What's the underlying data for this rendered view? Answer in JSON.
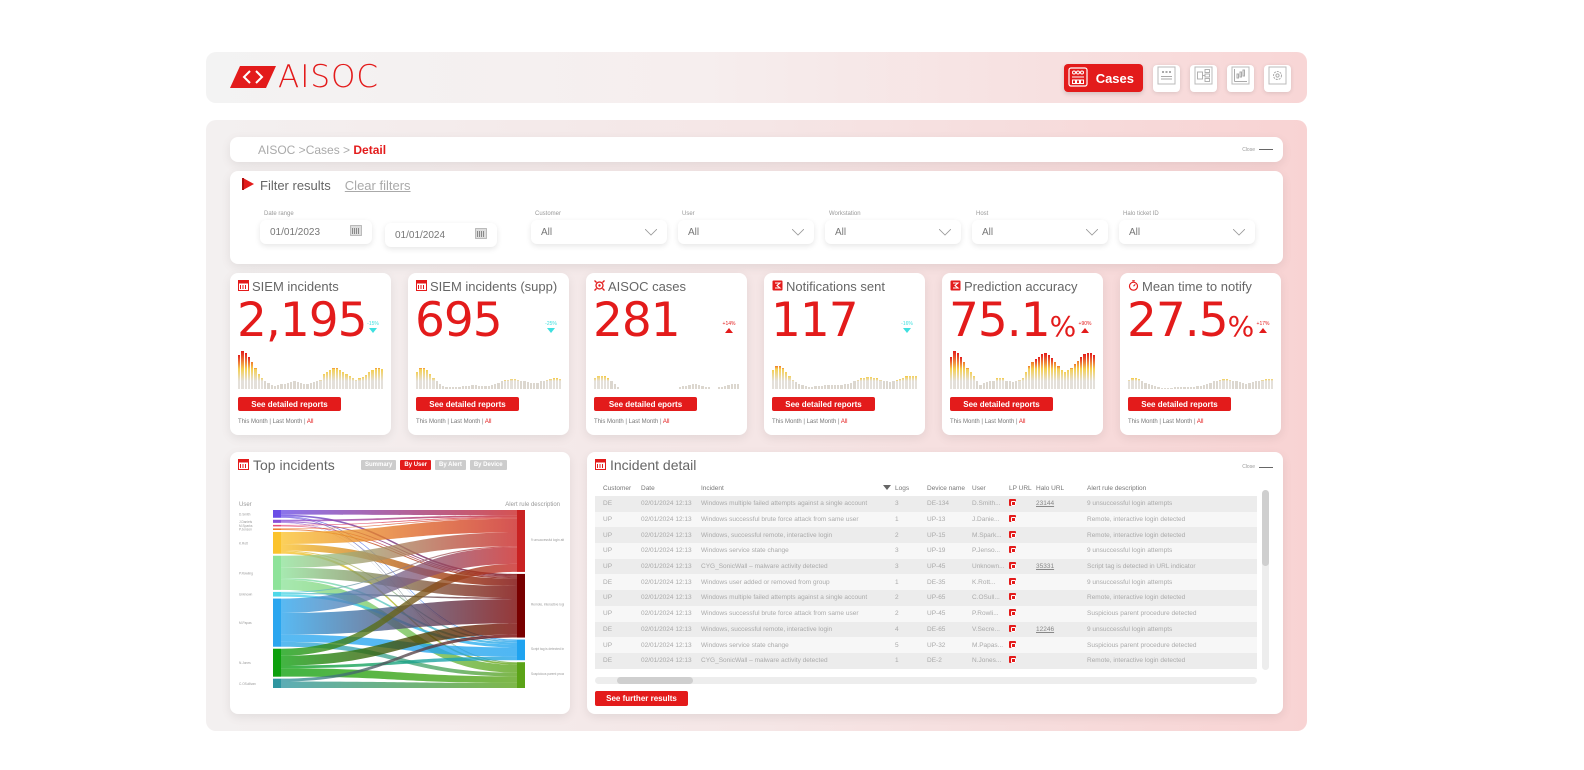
{
  "app": {
    "logo_text": "AISOC",
    "brand_color": "#e31b1b",
    "accent_down_color": "#3fe0e0"
  },
  "nav": {
    "cases_label": "Cases",
    "items": [
      {
        "icon": "cases-icon",
        "label": "Cases",
        "active": true
      },
      {
        "icon": "dashboard-icon",
        "active": false
      },
      {
        "icon": "network-icon",
        "active": false
      },
      {
        "icon": "chart-icon",
        "active": false
      },
      {
        "icon": "gear-icon",
        "active": false
      }
    ]
  },
  "breadcrumb": {
    "root": "AISOC",
    "sep1": " >",
    "mid": "Cases",
    "sep2": " > ",
    "current": "Detail",
    "close_label": "Close"
  },
  "filters": {
    "title": "Filter results",
    "clear_label": "Clear filters",
    "date_range_label": "Date range",
    "date_from": "01/01/2023",
    "date_to": "01/01/2024",
    "customer_label": "Customer",
    "customer_value": "All",
    "user_label": "User",
    "user_value": "All",
    "workstation_label": "Workstation",
    "workstation_value": "All",
    "host_label": "Host",
    "host_value": "All",
    "halo_label": "Halo ticket ID",
    "halo_value": "All"
  },
  "kpis": [
    {
      "title": "SIEM incidents",
      "icon": "calendar-icon",
      "value": "2,195",
      "suffix": "",
      "delta": "-15%",
      "direction": "down",
      "button": "See detailed reports",
      "spark": [
        0.9,
        1.0,
        0.95,
        0.85,
        0.7,
        0.55,
        0.4,
        0.3,
        0.22,
        0.15,
        0.1,
        0.08,
        0.1,
        0.12,
        0.12,
        0.15,
        0.18,
        0.2,
        0.18,
        0.15,
        0.14,
        0.13,
        0.15,
        0.18,
        0.2,
        0.25,
        0.4,
        0.45,
        0.5,
        0.55,
        0.55,
        0.5,
        0.45,
        0.4,
        0.35,
        0.3,
        0.25,
        0.28,
        0.32,
        0.38,
        0.45,
        0.5,
        0.55,
        0.55,
        0.52
      ]
    },
    {
      "title": "SIEM incidents (supp)",
      "icon": "calendar-icon",
      "value": "695",
      "suffix": "",
      "delta": "-25%",
      "direction": "down",
      "button": "See detailed reports",
      "spark": [
        0.45,
        0.55,
        0.55,
        0.5,
        0.4,
        0.3,
        0.2,
        0.12,
        0.08,
        0.06,
        0.05,
        0.05,
        0.05,
        0.06,
        0.07,
        0.08,
        0.09,
        0.1,
        0.1,
        0.09,
        0.08,
        0.08,
        0.09,
        0.1,
        0.12,
        0.15,
        0.2,
        0.23,
        0.25,
        0.27,
        0.27,
        0.25,
        0.22,
        0.2,
        0.18,
        0.16,
        0.15,
        0.17,
        0.2,
        0.22,
        0.25,
        0.27,
        0.28,
        0.28,
        0.27
      ]
    },
    {
      "title": "AISOC cases",
      "icon": "target-icon",
      "value": "281",
      "suffix": "",
      "delta": "+14%",
      "direction": "up",
      "button": "See detailed  eports",
      "spark": [
        0.3,
        0.35,
        0.35,
        0.33,
        0.28,
        0.2,
        0.12,
        0.06,
        0,
        0,
        0,
        0,
        0,
        0,
        0,
        0,
        0,
        0,
        0,
        0,
        0,
        0,
        0,
        0,
        0,
        0,
        0.05,
        0.07,
        0.08,
        0.1,
        0.12,
        0.12,
        0.1,
        0.08,
        0.06,
        0.04,
        0,
        0,
        0.04,
        0.06,
        0.08,
        0.1,
        0.12,
        0.12,
        0.12
      ]
    },
    {
      "title": "Notifications sent",
      "icon": "notification-icon",
      "value": "117",
      "suffix": "",
      "delta": "-16%",
      "direction": "down",
      "button": "See detailed reports",
      "spark": [
        0.5,
        0.6,
        0.6,
        0.55,
        0.45,
        0.35,
        0.25,
        0.18,
        0.12,
        0.1,
        0.08,
        0.06,
        0.06,
        0.07,
        0.08,
        0.09,
        0.1,
        0.1,
        0.1,
        0.1,
        0.1,
        0.1,
        0.12,
        0.14,
        0.16,
        0.2,
        0.25,
        0.28,
        0.3,
        0.32,
        0.32,
        0.3,
        0.28,
        0.25,
        0.22,
        0.2,
        0.18,
        0.2,
        0.23,
        0.26,
        0.3,
        0.33,
        0.35,
        0.35,
        0.35
      ]
    },
    {
      "title": "Prediction accuracy",
      "icon": "notification-icon",
      "value": "75.1",
      "suffix": "%",
      "delta": "+90%",
      "direction": "up",
      "button": "See detailed reports",
      "spark": [
        0.85,
        1.0,
        0.95,
        0.85,
        0.7,
        0.55,
        0.45,
        0.35,
        0.2,
        0.1,
        0.15,
        0.18,
        0.2,
        0.22,
        0.28,
        0.3,
        0.28,
        0.22,
        0.2,
        0.18,
        0.2,
        0.25,
        0.3,
        0.45,
        0.6,
        0.7,
        0.8,
        0.85,
        0.92,
        0.95,
        0.9,
        0.82,
        0.7,
        0.6,
        0.5,
        0.45,
        0.5,
        0.55,
        0.65,
        0.75,
        0.85,
        0.92,
        0.95,
        0.95,
        0.9
      ]
    },
    {
      "title": "Mean time to notify",
      "icon": "stopwatch-icon",
      "value": "27.5",
      "suffix": "%",
      "delta": "+17%",
      "direction": "up",
      "button": "See detailed reports",
      "spark": [
        0.25,
        0.28,
        0.28,
        0.26,
        0.2,
        0.15,
        0.12,
        0.1,
        0.08,
        0.05,
        0.03,
        0.02,
        0.02,
        0.03,
        0.04,
        0.05,
        0.06,
        0.06,
        0.06,
        0.06,
        0.06,
        0.07,
        0.08,
        0.1,
        0.12,
        0.15,
        0.2,
        0.22,
        0.24,
        0.26,
        0.26,
        0.25,
        0.22,
        0.2,
        0.18,
        0.16,
        0.14,
        0.16,
        0.18,
        0.2,
        0.22,
        0.24,
        0.26,
        0.27,
        0.27
      ]
    }
  ],
  "periods": {
    "this_month": "This Month",
    "last_month": "Last Month",
    "all": "All"
  },
  "top_incidents": {
    "title": "Top incidents",
    "tabs": [
      {
        "label": "Summary",
        "active": false
      },
      {
        "label": "By User",
        "active": true
      },
      {
        "label": "By Alert",
        "active": false
      },
      {
        "label": "By Device",
        "active": false
      }
    ],
    "left_axis_label": "User",
    "right_axis_label": "Alert rule description",
    "users": [
      {
        "name": "D.Smith",
        "weight": 5,
        "color": "#6a4de6"
      },
      {
        "name": "J.Daniels",
        "weight": 2,
        "color": "#8a4fd8"
      },
      {
        "name": "M.Sparks",
        "weight": 1,
        "color": "#e8507a"
      },
      {
        "name": "P.Jenson",
        "weight": 1,
        "color": "#f07a2a"
      },
      {
        "name": "K.Rott",
        "weight": 14,
        "color": "#fbc32c"
      },
      {
        "name": "P.Rowling",
        "weight": 22,
        "color": "#8ee39a"
      },
      {
        "name": "Unknown",
        "weight": 3,
        "color": "#4fd8e8"
      },
      {
        "name": "M.Papas",
        "weight": 31,
        "color": "#2aa6ef"
      },
      {
        "name": "N.Jones",
        "weight": 18,
        "color": "#0da00d"
      },
      {
        "name": "C.OSullivan",
        "weight": 6,
        "color": "#2f96a0"
      }
    ],
    "alerts": [
      {
        "name": "9 unsuccessful login attempts",
        "weight": 36,
        "color": "#c92222"
      },
      {
        "name": "Remote, interactive login detected",
        "weight": 37,
        "color": "#780000"
      },
      {
        "name": "Script tag is detected in URL indicator",
        "weight": 12,
        "color": "#1fa3f0"
      },
      {
        "name": "Suspicious parent procedure detected",
        "weight": 15,
        "color": "#5ba317"
      }
    ]
  },
  "incident_detail": {
    "title": "Incident detail",
    "close_label": "Close",
    "columns": [
      "Customer",
      "Date",
      "Incident",
      "Logs",
      "Device name",
      "User",
      "LP URL",
      "Halo URL",
      "Alert rule description"
    ],
    "rows": [
      {
        "customer": "DE",
        "date": "02/01/2024 12:13",
        "incident": "Windows multiple failed attempts against a single account",
        "logs": "3",
        "device": "DE-134",
        "user": "D.Smith...",
        "halo": "23144",
        "alert": "9 unsuccessful login attempts"
      },
      {
        "customer": "UP",
        "date": "02/01/2024 12:13",
        "incident": "Windows successful brute force attack from same user",
        "logs": "1",
        "device": "UP-13",
        "user": "J.Danie...",
        "halo": "",
        "alert": "Remote, interactive login detected"
      },
      {
        "customer": "UP",
        "date": "02/01/2024 12:13",
        "incident": "Windows, successful remote, interactive login",
        "logs": "2",
        "device": "UP-15",
        "user": "M.Spark...",
        "halo": "",
        "alert": "Remote, interactive login detected"
      },
      {
        "customer": "UP",
        "date": "02/01/2024 12:13",
        "incident": "Windows service state change",
        "logs": "3",
        "device": "UP-19",
        "user": "P.Jenso...",
        "halo": "",
        "alert": "9 unsuccessful login attempts"
      },
      {
        "customer": "UP",
        "date": "02/01/2024 12:13",
        "incident": "CYG_SonicWall – malware activity detected",
        "logs": "3",
        "device": "UP-45",
        "user": "Unknown...",
        "halo": "35331",
        "alert": "Script tag is detected in URL indicator"
      },
      {
        "customer": "DE",
        "date": "02/01/2024 12:13",
        "incident": "Windows user added or removed from group",
        "logs": "1",
        "device": "DE-35",
        "user": "K.Rott...",
        "halo": "",
        "alert": "9 unsuccessful login attempts"
      },
      {
        "customer": "UP",
        "date": "02/01/2024 12:13",
        "incident": "Windows multiple failed attempts against a single account",
        "logs": "2",
        "device": "UP-65",
        "user": "C.OSull...",
        "halo": "",
        "alert": "Remote, interactive login detected"
      },
      {
        "customer": "UP",
        "date": "02/01/2024 12:13",
        "incident": "Windows successful brute force attack from same user",
        "logs": "2",
        "device": "UP-45",
        "user": "P.Rowli...",
        "halo": "",
        "alert": "Suspicious parent procedure detected"
      },
      {
        "customer": "DE",
        "date": "02/01/2024 12:13",
        "incident": "Windows, successful remote, interactive login",
        "logs": "4",
        "device": "DE-65",
        "user": "V.Secre...",
        "halo": "12246",
        "alert": "9 unsuccessful login attempts"
      },
      {
        "customer": "UP",
        "date": "02/01/2024 12:13",
        "incident": "Windows service state change",
        "logs": "5",
        "device": "UP-32",
        "user": "M.Papas...",
        "halo": "",
        "alert": "Suspicious parent procedure detected"
      },
      {
        "customer": "DE",
        "date": "02/01/2024 12:13",
        "incident": "CYG_SonicWall – malware activity detected",
        "logs": "1",
        "device": "DE-2",
        "user": "N.Jones...",
        "halo": "",
        "alert": "Remote, interactive login detected"
      }
    ],
    "further_label": "See further results"
  }
}
